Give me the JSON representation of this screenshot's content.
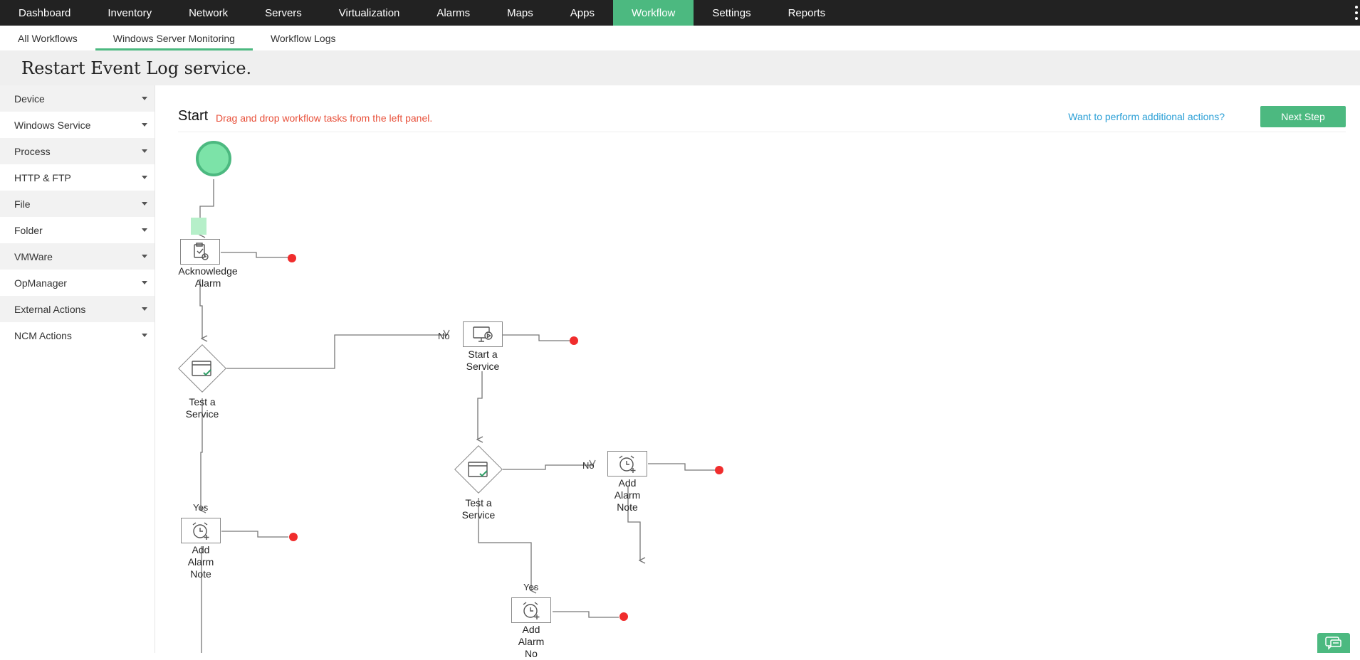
{
  "nav": {
    "tabs": [
      {
        "label": "Dashboard"
      },
      {
        "label": "Inventory"
      },
      {
        "label": "Network"
      },
      {
        "label": "Servers"
      },
      {
        "label": "Virtualization"
      },
      {
        "label": "Alarms"
      },
      {
        "label": "Maps"
      },
      {
        "label": "Apps"
      },
      {
        "label": "Workflow",
        "active": true
      },
      {
        "label": "Settings"
      },
      {
        "label": "Reports"
      }
    ]
  },
  "subnav": {
    "tabs": [
      {
        "label": "All Workflows"
      },
      {
        "label": "Windows Server Monitoring",
        "active": true
      },
      {
        "label": "Workflow Logs"
      }
    ]
  },
  "page": {
    "title": "Restart Event Log service."
  },
  "sidebar": {
    "items": [
      {
        "label": "Device"
      },
      {
        "label": "Windows Service"
      },
      {
        "label": "Process"
      },
      {
        "label": "HTTP & FTP"
      },
      {
        "label": "File"
      },
      {
        "label": "Folder"
      },
      {
        "label": "VMWare"
      },
      {
        "label": "OpManager"
      },
      {
        "label": "External Actions"
      },
      {
        "label": "NCM Actions"
      }
    ]
  },
  "canvas": {
    "start_label": "Start",
    "hint": "Drag and drop workflow tasks from the left panel.",
    "more_actions_link": "Want to perform additional actions?",
    "next_button": "Next Step"
  },
  "flow": {
    "nodes": {
      "ack": {
        "label": "Acknowledge\nAlarm",
        "icon": "acknowledge-alarm-icon"
      },
      "test1": {
        "label": "Test a\nService",
        "icon": "test-service-icon"
      },
      "start_svc": {
        "label": "Start a\nService",
        "icon": "start-service-icon"
      },
      "test2": {
        "label": "Test a\nService",
        "icon": "test-service-icon"
      },
      "note_no": {
        "label": "Add\nAlarm\nNote",
        "icon": "add-alarm-note-icon"
      },
      "note_yes1": {
        "label": "Add\nAlarm\nNote",
        "icon": "add-alarm-note-icon"
      },
      "note_yes2": {
        "label": "Add\nAlarm\nNo",
        "icon": "add-alarm-note-icon"
      }
    },
    "edge_labels": {
      "no1": "No",
      "no2": "No",
      "yes1": "Yes",
      "yes2": "Yes"
    },
    "colors": {
      "accent": "#4cb980",
      "endpoint": "#f02d2d",
      "link": "#2a9fd6",
      "hint": "#e8503a"
    }
  }
}
